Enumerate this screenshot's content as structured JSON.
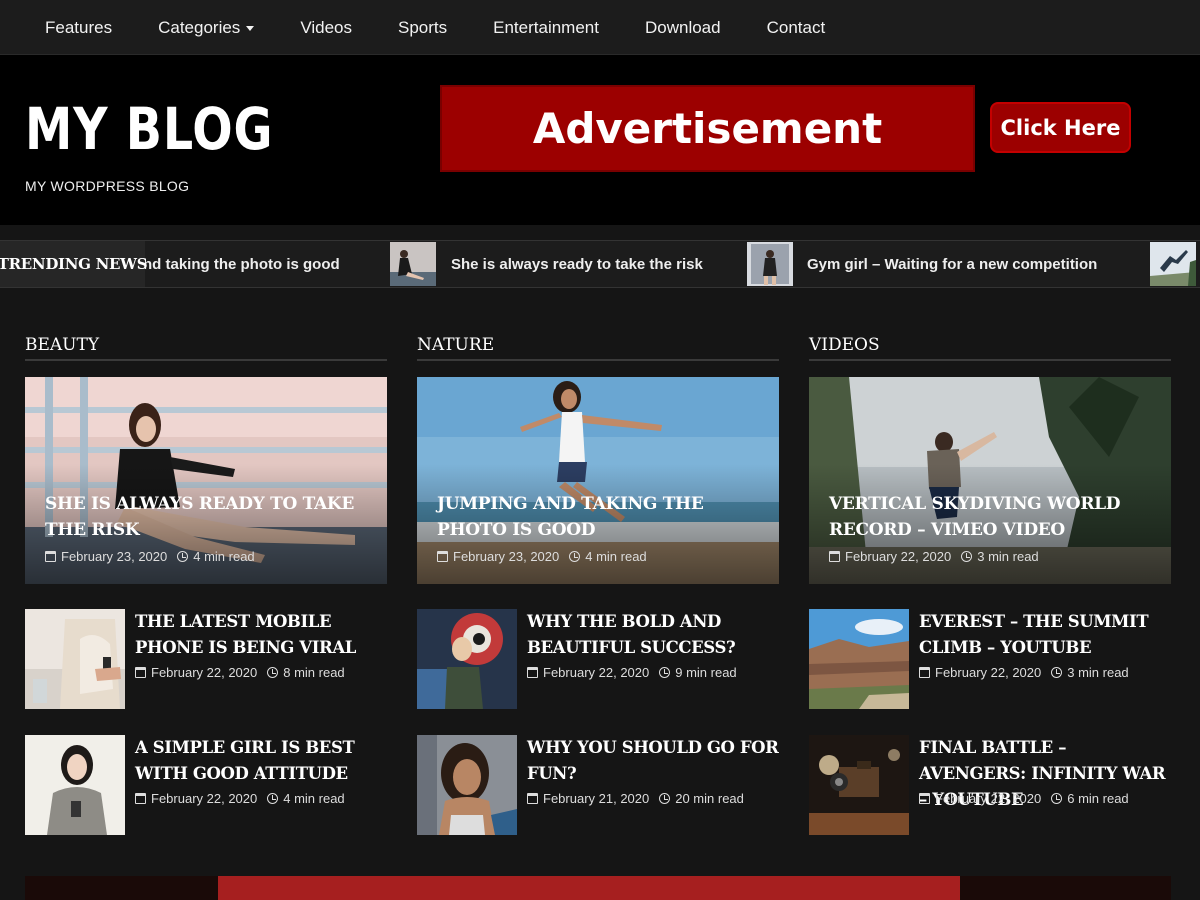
{
  "nav": {
    "items": [
      "Features",
      "Categories",
      "Videos",
      "Sports",
      "Entertainment",
      "Download",
      "Contact"
    ]
  },
  "header": {
    "logo": "MY BLOG",
    "tagline": "MY WORDPRESS BLOG",
    "ad_text": "Advertisement",
    "ad_button": "Click Here"
  },
  "ticker": {
    "label": "TRENDING NEWS",
    "items": [
      "nd taking the photo is good",
      "She is always ready to take the risk",
      "Gym girl – Waiting for a new competition"
    ]
  },
  "sections": [
    {
      "title": "BEAUTY",
      "featured": {
        "title": "She is always ready to take the risk",
        "date": "February 23, 2020",
        "read": "4 min read"
      },
      "items": [
        {
          "title": "The latest mobile phone is being viral",
          "date": "February 22, 2020",
          "read": "8 min read"
        },
        {
          "title": "A simple girl is best with good attitude",
          "date": "February 22, 2020",
          "read": "4 min read"
        }
      ]
    },
    {
      "title": "NATURE",
      "featured": {
        "title": "Jumping and taking the photo is good",
        "date": "February 23, 2020",
        "read": "4 min read"
      },
      "items": [
        {
          "title": "Why the bold and beautiful success?",
          "date": "February 22, 2020",
          "read": "9 min read"
        },
        {
          "title": "Why you should go for fun?",
          "date": "February 21, 2020",
          "read": "20 min read"
        }
      ]
    },
    {
      "title": "VIDEOS",
      "featured": {
        "title": "Vertical Skydiving World Record – Vimeo Video",
        "date": "February 22, 2020",
        "read": "3 min read"
      },
      "items": [
        {
          "title": "Everest – The Summit Climb – YouTube",
          "date": "February 22, 2020",
          "read": "3 min read"
        },
        {
          "title": "Final Battle – Avengers: Infinity War – YouTube",
          "date": "February 22, 2020",
          "read": "6 min read"
        }
      ]
    }
  ]
}
